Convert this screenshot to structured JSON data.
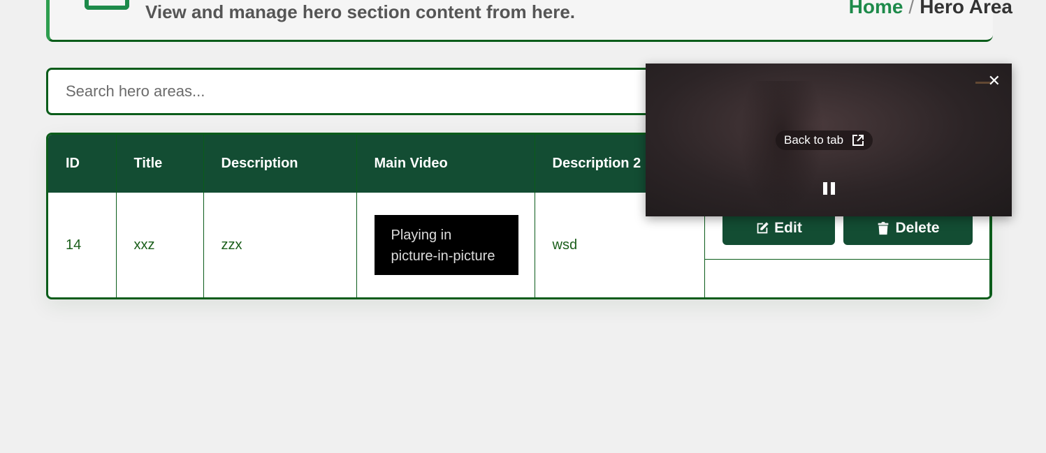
{
  "header": {
    "subtitle": "View and manage hero section content from here.",
    "breadcrumb": {
      "home": "Home",
      "separator": "/",
      "current": "Hero Area"
    }
  },
  "search": {
    "placeholder": "Search hero areas...",
    "value": ""
  },
  "table": {
    "columns": [
      "ID",
      "Title",
      "Description",
      "Main Video",
      "Description 2"
    ],
    "rows": [
      {
        "id": "14",
        "title": "xxz",
        "description": "zzx",
        "video_text": "Playing in picture-in-picture",
        "description2": "wsd"
      }
    ],
    "actions": {
      "edit": "Edit",
      "delete": "Delete"
    }
  },
  "pip": {
    "back_label": "Back to tab"
  },
  "colors": {
    "accent": "#134d33",
    "border": "#0a5c1a",
    "link": "#1d8a4a"
  }
}
